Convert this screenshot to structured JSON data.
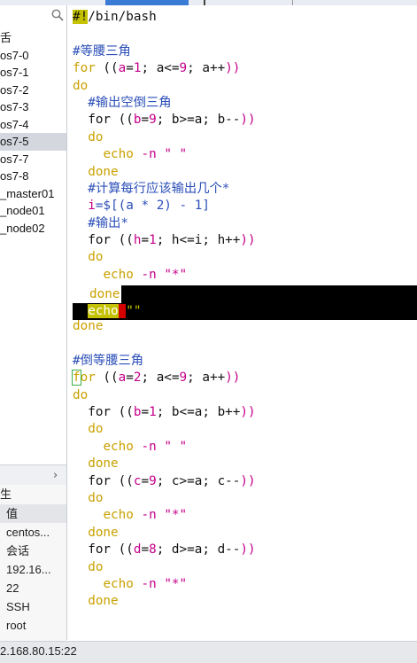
{
  "sidebar": {
    "items": [
      {
        "label": "舌",
        "selected": false
      },
      {
        "label": "os7-0",
        "selected": false
      },
      {
        "label": "os7-1",
        "selected": false
      },
      {
        "label": "os7-2",
        "selected": false
      },
      {
        "label": "os7-3",
        "selected": false
      },
      {
        "label": "os7-4",
        "selected": false
      },
      {
        "label": "os7-5",
        "selected": true
      },
      {
        "label": "os7-7",
        "selected": false
      },
      {
        "label": "os7-8",
        "selected": false
      },
      {
        "label": "_master01",
        "selected": false
      },
      {
        "label": "_node01",
        "selected": false
      },
      {
        "label": "_node02",
        "selected": false
      }
    ],
    "chevron": "›",
    "props_title": "生",
    "props_header": "值",
    "props_rows": [
      "centos...",
      "会话",
      "192.16...",
      "22",
      "SSH",
      "root"
    ]
  },
  "status": {
    "text": "2.168.80.15:22"
  },
  "editor": {
    "shebang_mark": "#!",
    "shebang_rest": "/bin/bash",
    "c1": "#等腰三角",
    "c2": "#输出空倒三角",
    "c3": "#计算每行应该输出几个*",
    "c4": "#输出*",
    "c5": "#倒等腰三角",
    "kw_for": "for",
    "kw_f": "f",
    "kw_or": "or",
    "kw_do": "do",
    "kw_done": "done",
    "kw_echo": "echo",
    "opt_n": "-n",
    "str_space": "\" \"",
    "str_star": "\"*\"",
    "str_empty_q1": "\"",
    "str_empty_q2": "\"",
    "l_for1_a": " ((",
    "l_for1_var": "a",
    "l_for1_b": "=",
    "l_for1_n1": "1",
    "l_for1_c": "; a<=",
    "l_for1_n2": "9",
    "l_for1_d": "; a++",
    "l_for1_e": "))",
    "l_for2_var": "b",
    "l_for2_n1": "9",
    "l_for2_c": "; b>=a; b--",
    "l_i_var": "i",
    "l_i_rest": "=$[(a * 2) - 1]",
    "l_for3_var": "h",
    "l_for3_n1": "1",
    "l_for3_c": "; h<=i; h++",
    "l_for4_var": "a",
    "l_for4_n1": "2",
    "l_for4_c": "; a<=",
    "l_for4_n2": "9",
    "l_for4_d": "; a++",
    "l_for5_var": "b",
    "l_for5_n1": "1",
    "l_for5_c": "; b<=a; b++",
    "l_for6_var": "c",
    "l_for6_n1": "9",
    "l_for6_c": "; c>=a; c--",
    "l_for7_var": "d",
    "l_for7_n1": "8",
    "l_for7_c": "; d>=a; d--"
  },
  "colors": {
    "keyword": "#c9a100",
    "comment": "#2c4fb8",
    "variable": "#c4008a",
    "selection": "#000000"
  }
}
